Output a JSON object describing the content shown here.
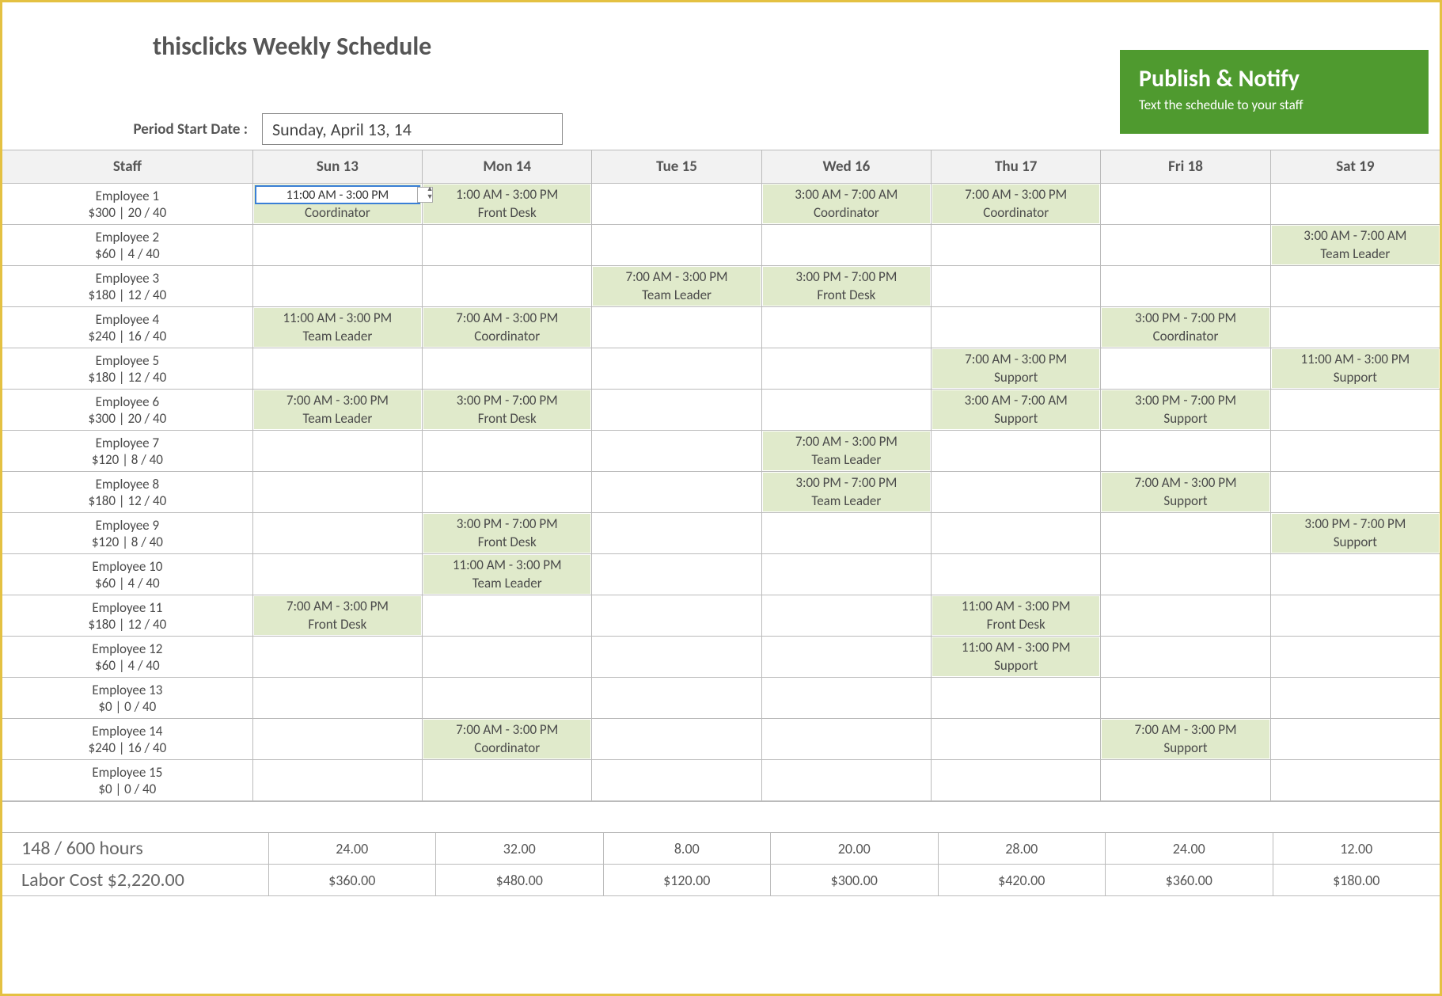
{
  "header": {
    "title": "thisclicks Weekly Schedule",
    "date_label": "Period Start Date :",
    "date_value": "Sunday, April 13, 14",
    "publish_title": "Publish & Notify",
    "publish_sub": "Text the schedule to your staff"
  },
  "columns": [
    "Staff",
    "Sun 13",
    "Mon 14",
    "Tue 15",
    "Wed 16",
    "Thu 17",
    "Fri 18",
    "Sat 19"
  ],
  "selected_cell": {
    "row": 0,
    "col": 1,
    "text": "11:00 AM - 3:00 PM"
  },
  "employees": [
    {
      "name": "Employee 1",
      "meta": "$300 | 20 / 40",
      "cells": [
        {
          "t": "11:00 AM - 3:00 PM",
          "r": "Coordinator"
        },
        {
          "t": "1:00 AM - 3:00 PM",
          "r": "Front Desk"
        },
        null,
        {
          "t": "3:00 AM - 7:00 AM",
          "r": "Coordinator"
        },
        {
          "t": "7:00 AM - 3:00 PM",
          "r": "Coordinator"
        },
        null,
        null
      ]
    },
    {
      "name": "Employee 2",
      "meta": "$60 | 4 / 40",
      "cells": [
        null,
        null,
        null,
        null,
        null,
        null,
        {
          "t": "3:00 AM - 7:00 AM",
          "r": "Team Leader"
        }
      ]
    },
    {
      "name": "Employee 3",
      "meta": "$180 | 12 / 40",
      "cells": [
        null,
        null,
        {
          "t": "7:00 AM - 3:00 PM",
          "r": "Team Leader"
        },
        {
          "t": "3:00 PM - 7:00 PM",
          "r": "Front Desk"
        },
        null,
        null,
        null
      ]
    },
    {
      "name": "Employee 4",
      "meta": "$240 | 16 / 40",
      "cells": [
        {
          "t": "11:00 AM - 3:00 PM",
          "r": "Team Leader"
        },
        {
          "t": "7:00 AM - 3:00 PM",
          "r": "Coordinator"
        },
        null,
        null,
        null,
        {
          "t": "3:00 PM - 7:00 PM",
          "r": "Coordinator"
        },
        null
      ]
    },
    {
      "name": "Employee 5",
      "meta": "$180 | 12 / 40",
      "cells": [
        null,
        null,
        null,
        null,
        {
          "t": "7:00 AM - 3:00 PM",
          "r": "Support"
        },
        null,
        {
          "t": "11:00 AM - 3:00 PM",
          "r": "Support"
        }
      ]
    },
    {
      "name": "Employee 6",
      "meta": "$300 | 20 / 40",
      "cells": [
        {
          "t": "7:00 AM - 3:00 PM",
          "r": "Team Leader"
        },
        {
          "t": "3:00 PM - 7:00 PM",
          "r": "Front Desk"
        },
        null,
        null,
        {
          "t": "3:00 AM - 7:00 AM",
          "r": "Support"
        },
        {
          "t": "3:00 PM - 7:00 PM",
          "r": "Support"
        },
        null
      ]
    },
    {
      "name": "Employee 7",
      "meta": "$120 | 8 / 40",
      "cells": [
        null,
        null,
        null,
        {
          "t": "7:00 AM - 3:00 PM",
          "r": "Team Leader"
        },
        null,
        null,
        null
      ]
    },
    {
      "name": "Employee 8",
      "meta": "$180 | 12 / 40",
      "cells": [
        null,
        null,
        null,
        {
          "t": "3:00 PM - 7:00 PM",
          "r": "Team Leader"
        },
        null,
        {
          "t": "7:00 AM - 3:00 PM",
          "r": "Support"
        },
        null
      ]
    },
    {
      "name": "Employee 9",
      "meta": "$120 | 8 / 40",
      "cells": [
        null,
        {
          "t": "3:00 PM - 7:00 PM",
          "r": "Front Desk"
        },
        null,
        null,
        null,
        null,
        {
          "t": "3:00 PM - 7:00 PM",
          "r": "Support"
        }
      ]
    },
    {
      "name": "Employee 10",
      "meta": "$60 | 4 / 40",
      "cells": [
        null,
        {
          "t": "11:00 AM - 3:00 PM",
          "r": "Team Leader"
        },
        null,
        null,
        null,
        null,
        null
      ]
    },
    {
      "name": "Employee 11",
      "meta": "$180 | 12 / 40",
      "cells": [
        {
          "t": "7:00 AM - 3:00 PM",
          "r": "Front Desk"
        },
        null,
        null,
        null,
        {
          "t": "11:00 AM - 3:00 PM",
          "r": "Front Desk"
        },
        null,
        null
      ]
    },
    {
      "name": "Employee 12",
      "meta": "$60 | 4 / 40",
      "cells": [
        null,
        null,
        null,
        null,
        {
          "t": "11:00 AM - 3:00 PM",
          "r": "Support"
        },
        null,
        null
      ]
    },
    {
      "name": "Employee 13",
      "meta": "$0 | 0 / 40",
      "cells": [
        null,
        null,
        null,
        null,
        null,
        null,
        null
      ]
    },
    {
      "name": "Employee 14",
      "meta": "$240 | 16 / 40",
      "cells": [
        null,
        {
          "t": "7:00 AM - 3:00 PM",
          "r": "Coordinator"
        },
        null,
        null,
        null,
        {
          "t": "7:00 AM - 3:00 PM",
          "r": "Support"
        },
        null
      ]
    },
    {
      "name": "Employee 15",
      "meta": "$0 | 0 / 40",
      "cells": [
        null,
        null,
        null,
        null,
        null,
        null,
        null
      ]
    }
  ],
  "footer": {
    "hours_label": "148 / 600 hours",
    "hours": [
      "24.00",
      "32.00",
      "8.00",
      "20.00",
      "28.00",
      "24.00",
      "12.00"
    ],
    "cost_label": "Labor Cost $2,220.00",
    "costs": [
      "$360.00",
      "$480.00",
      "$120.00",
      "$300.00",
      "$420.00",
      "$360.00",
      "$180.00"
    ]
  }
}
